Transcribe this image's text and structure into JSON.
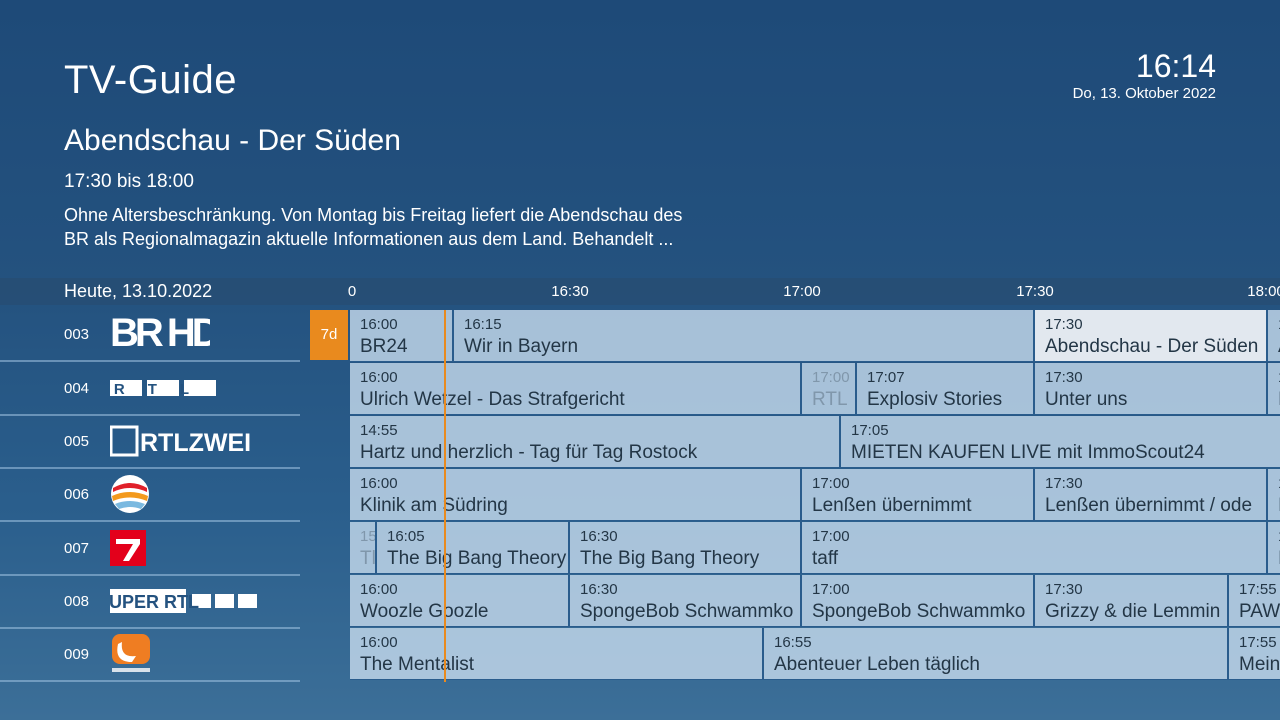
{
  "header": {
    "title": "TV-Guide",
    "clock": "16:14",
    "date": "Do, 13. Oktober 2022"
  },
  "details": {
    "title": "Abendschau - Der Süden",
    "time": "17:30 bis 18:00",
    "description_line1": "Ohne Altersbeschränkung. Von Montag bis Freitag liefert die Abendschau des",
    "description_line2": "BR als Regionalmagazin aktuelle Informationen aus dem Land. Behandelt ..."
  },
  "timeline": {
    "today": "Heute, 13.10.2022",
    "ticks": [
      "0",
      "16:30",
      "17:00",
      "17:30",
      "18:00"
    ]
  },
  "tag": "7d",
  "colors": {
    "accent": "#e98a1e",
    "cell": "#c8dcee",
    "selected": "#ecf0f4"
  },
  "channels": [
    {
      "number": "003",
      "logo": "BR HD"
    },
    {
      "number": "004",
      "logo": "RTL"
    },
    {
      "number": "005",
      "logo": "RTLZWEI"
    },
    {
      "number": "006",
      "logo": "sat1-logo-icon"
    },
    {
      "number": "007",
      "logo": "prosieben-logo-icon"
    },
    {
      "number": "008",
      "logo": "SUPER RTL"
    },
    {
      "number": "009",
      "logo": "kabel-eins-logo-icon"
    }
  ],
  "programs": [
    [
      {
        "time": "16:00",
        "title": "BR24"
      },
      {
        "time": "16:15",
        "title": "Wir in Bayern"
      },
      {
        "time": "17:30",
        "title": "Abendschau - Der Süden",
        "selected": true
      },
      {
        "time": "1",
        "title": "A"
      }
    ],
    [
      {
        "time": "16:00",
        "title": "Ulrich Wetzel - Das Strafgericht"
      },
      {
        "time": "17:00",
        "title": "RTL",
        "dim": true
      },
      {
        "time": "17:07",
        "title": "Explosiv Stories"
      },
      {
        "time": "17:30",
        "title": "Unter uns"
      },
      {
        "time": "1",
        "title": "I"
      }
    ],
    [
      {
        "time": "14:55",
        "title": "Hartz und herzlich - Tag für Tag Rostock"
      },
      {
        "time": "17:05",
        "title": "MIETEN KAUFEN LIVE mit ImmoScout24"
      }
    ],
    [
      {
        "time": "16:00",
        "title": "Klinik am Südring"
      },
      {
        "time": "17:00",
        "title": "Lenßen übernimmt"
      },
      {
        "time": "17:30",
        "title": "Lenßen übernimmt / ode"
      },
      {
        "time": "1",
        "title": "I"
      }
    ],
    [
      {
        "time": "15",
        "title": "Tl",
        "dim": true
      },
      {
        "time": "16:05",
        "title": "The Big Bang Theory"
      },
      {
        "time": "16:30",
        "title": "The Big Bang Theory"
      },
      {
        "time": "17:00",
        "title": "taff"
      },
      {
        "time": "1",
        "title": "I"
      }
    ],
    [
      {
        "time": "16:00",
        "title": "Woozle Goozle"
      },
      {
        "time": "16:30",
        "title": "SpongeBob Schwammko"
      },
      {
        "time": "17:00",
        "title": "SpongeBob Schwammko"
      },
      {
        "time": "17:30",
        "title": "Grizzy & die Lemmin"
      },
      {
        "time": "17:55",
        "title": "PAW"
      }
    ],
    [
      {
        "time": "16:00",
        "title": "The Mentalist"
      },
      {
        "time": "16:55",
        "title": "Abenteuer Leben täglich"
      },
      {
        "time": "17:55",
        "title": "Mein"
      }
    ]
  ]
}
